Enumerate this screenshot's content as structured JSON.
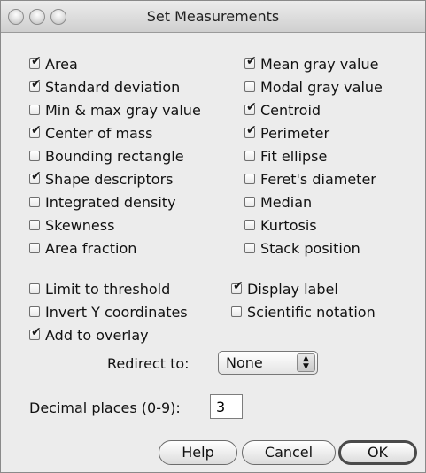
{
  "window": {
    "title": "Set Measurements"
  },
  "measurements": {
    "left": [
      {
        "label": "Area",
        "checked": true
      },
      {
        "label": "Standard deviation",
        "checked": true
      },
      {
        "label": "Min & max gray value",
        "checked": false
      },
      {
        "label": "Center of mass",
        "checked": true
      },
      {
        "label": "Bounding rectangle",
        "checked": false
      },
      {
        "label": "Shape descriptors",
        "checked": true
      },
      {
        "label": "Integrated density",
        "checked": false
      },
      {
        "label": "Skewness",
        "checked": false
      },
      {
        "label": "Area fraction",
        "checked": false
      }
    ],
    "right": [
      {
        "label": "Mean gray value",
        "checked": true
      },
      {
        "label": "Modal gray value",
        "checked": false
      },
      {
        "label": "Centroid",
        "checked": true
      },
      {
        "label": "Perimeter",
        "checked": true
      },
      {
        "label": "Fit ellipse",
        "checked": false
      },
      {
        "label": "Feret's diameter",
        "checked": false
      },
      {
        "label": "Median",
        "checked": false
      },
      {
        "label": "Kurtosis",
        "checked": false
      },
      {
        "label": "Stack position",
        "checked": false
      }
    ]
  },
  "options": {
    "limit_to_threshold": {
      "label": "Limit to threshold",
      "checked": false
    },
    "display_label": {
      "label": "Display label",
      "checked": true
    },
    "invert_y": {
      "label": "Invert Y coordinates",
      "checked": false
    },
    "scientific_notation": {
      "label": "Scientific notation",
      "checked": false
    },
    "add_to_overlay": {
      "label": "Add to overlay",
      "checked": true
    }
  },
  "redirect": {
    "label": "Redirect to:",
    "value": "None"
  },
  "decimal": {
    "label": "Decimal places (0-9):",
    "value": "3"
  },
  "buttons": {
    "help": "Help",
    "cancel": "Cancel",
    "ok": "OK"
  },
  "check_glyph": "✔"
}
